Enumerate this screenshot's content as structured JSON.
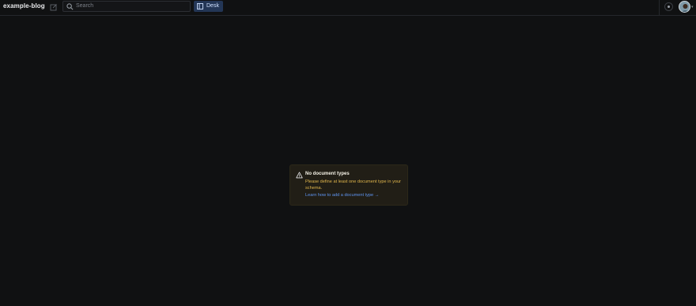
{
  "header": {
    "brand": "example-blog",
    "search_placeholder": "Search",
    "tool_label": "Desk"
  },
  "icons": {
    "compose": "compose-icon",
    "search": "search-icon",
    "desk": "desk-icon",
    "status": "status-icon",
    "avatar": "avatar",
    "warning": "warning-icon"
  },
  "notice": {
    "title": "No document types",
    "body": "Please define at least one document type in your schema.",
    "link": "Learn how to add a document type →"
  },
  "colors": {
    "background": "#101112",
    "accent": "#233656",
    "warning": "#e0b64c",
    "link": "#5f94ef"
  }
}
